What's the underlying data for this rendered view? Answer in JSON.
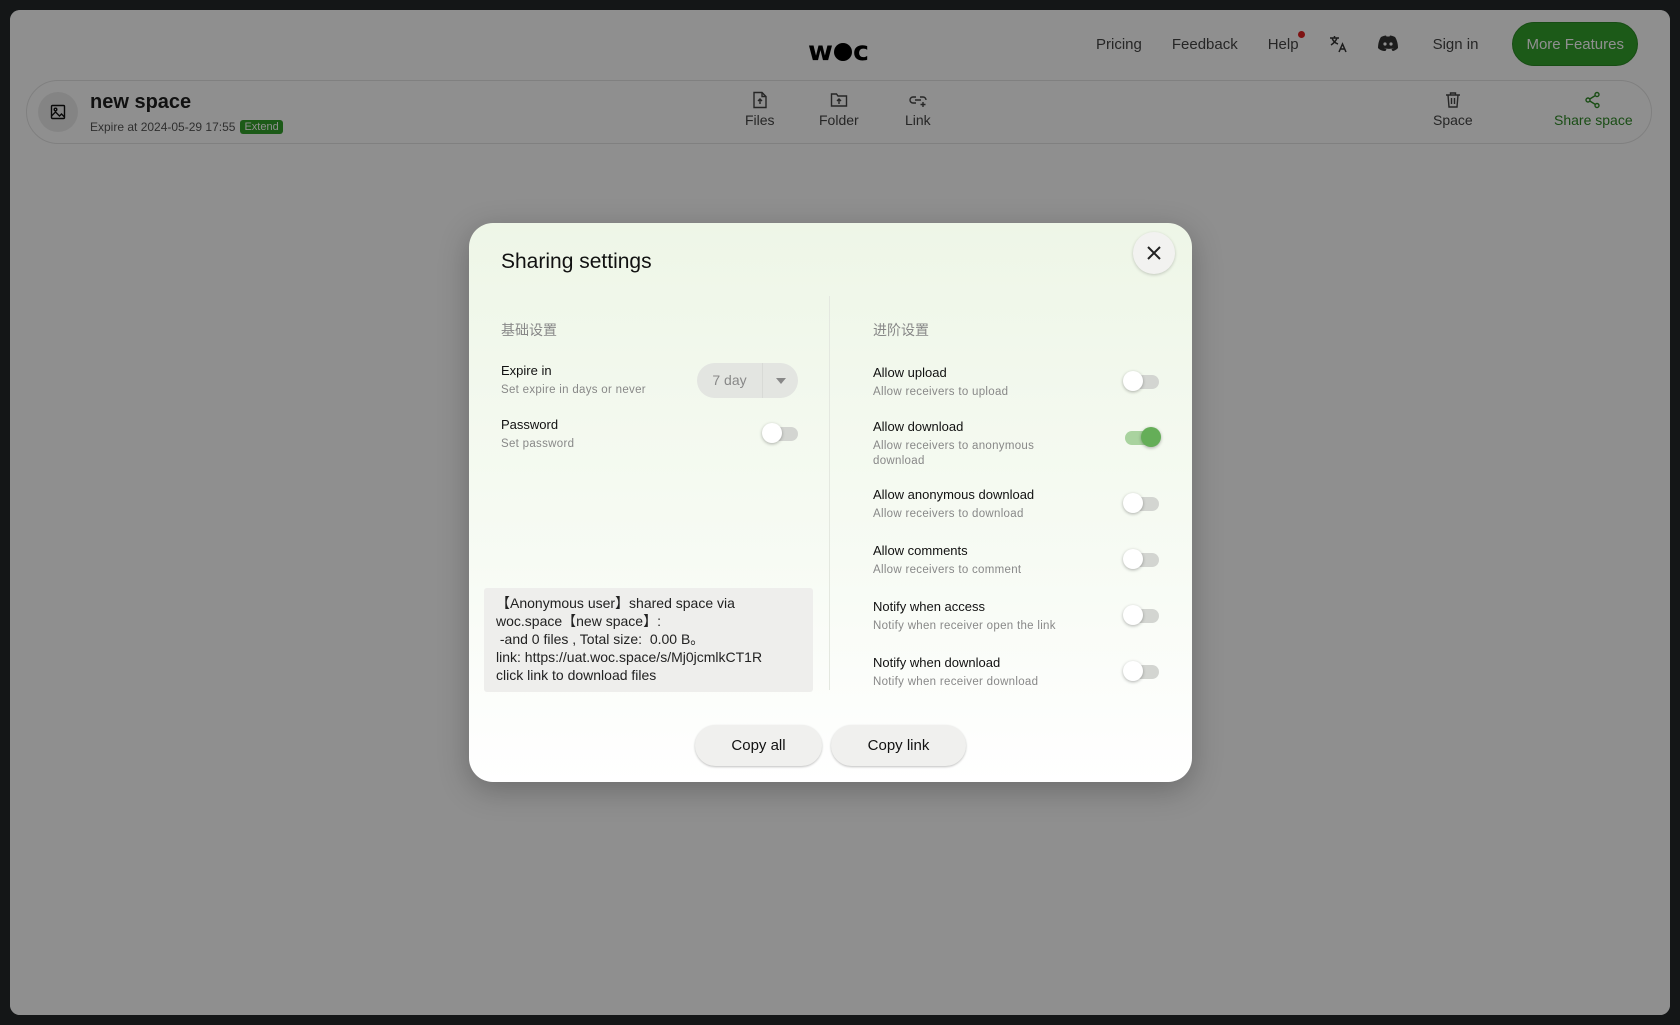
{
  "header": {
    "logo": {
      "left": "w",
      "right": "c"
    },
    "nav": {
      "pricing": "Pricing",
      "feedback": "Feedback",
      "help": "Help",
      "sign_in": "Sign in",
      "more_features": "More Features"
    },
    "icons": [
      "translate-icon",
      "discord-icon"
    ]
  },
  "space": {
    "title": "new space",
    "expire_text": "Expire at 2024-05-29 17:55",
    "extend_label": "Extend",
    "tools": {
      "files": "Files",
      "folder": "Folder",
      "link": "Link",
      "delete_space": "Space",
      "share_space": "Share space"
    }
  },
  "colors": {
    "accent": "#33a02c",
    "toggle_on": "#65ae58",
    "notification_dot": "#e02020"
  },
  "modal": {
    "title": "Sharing settings",
    "basic": {
      "section_title": "基础设置",
      "expire": {
        "label": "Expire in",
        "desc": "Set expire in days or never",
        "value": "7 day"
      },
      "password": {
        "label": "Password",
        "desc": "Set password",
        "enabled": false
      }
    },
    "advanced": {
      "section_title": "进阶设置",
      "items": [
        {
          "label": "Allow upload",
          "desc": "Allow receivers to upload",
          "enabled": false
        },
        {
          "label": "Allow download",
          "desc": "Allow receivers to anonymous download",
          "enabled": true
        },
        {
          "label": "Allow anonymous download",
          "desc": "Allow receivers to download",
          "enabled": false
        },
        {
          "label": "Allow comments",
          "desc": "Allow receivers to comment",
          "enabled": false
        },
        {
          "label": "Notify when access",
          "desc": "Notify when receiver open the link",
          "enabled": false
        },
        {
          "label": "Notify when download",
          "desc": "Notify when receiver download",
          "enabled": false
        }
      ]
    },
    "share_text": "【Anonymous user】shared space via\nwoc.space【new space】:\n -and 0 files , Total size:  0.00 B。\nlink: https://uat.woc.space/s/Mj0jcmlkCT1R\nclick link to download files",
    "buttons": {
      "copy_all": "Copy all",
      "copy_link": "Copy link"
    }
  }
}
